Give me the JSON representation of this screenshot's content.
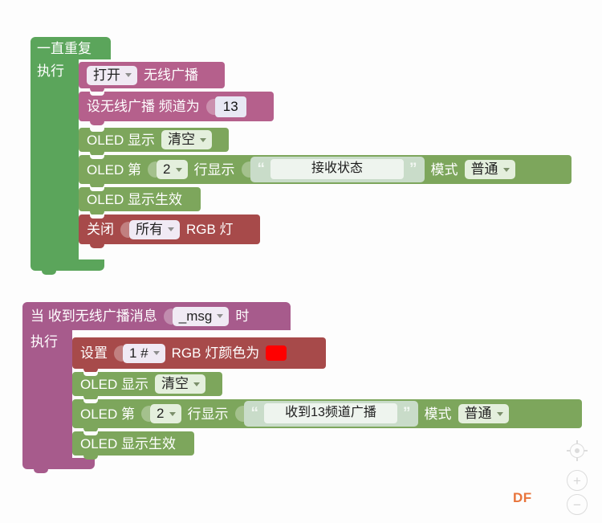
{
  "app": {
    "watermark": "DF",
    "background": "#fdfdfd"
  },
  "colors": {
    "loop_green": "#5BA55B",
    "oled_green": "#7DA65C",
    "wireless_pink": "#B5608C",
    "event_hat_purple": "#A75B8C",
    "rgb_red": "#A74A4A",
    "swatch_red": "#FF0000",
    "watermark_orange": "#E8743B"
  },
  "programs": [
    {
      "id": "forever-program",
      "header_label": "一直重复",
      "body_label": "执行",
      "statements": [
        {
          "id": "wireless-switch",
          "kind": "wireless",
          "prefix": "",
          "dropdown": "打开",
          "suffix": "无线广播"
        },
        {
          "id": "wireless-channel",
          "kind": "wireless",
          "prefix": "设无线广播 频道为",
          "number": "13"
        },
        {
          "id": "oled-show-clear",
          "kind": "oled",
          "prefix": "OLED 显示",
          "dropdown": "清空"
        },
        {
          "id": "oled-line-text",
          "kind": "oled",
          "prefix": "OLED 第",
          "line_dropdown": "2",
          "mid": "行显示",
          "text_value": "接收状态",
          "mode_label": "模式",
          "mode_dropdown": "普通"
        },
        {
          "id": "oled-refresh",
          "kind": "oled",
          "prefix": "OLED 显示生效"
        },
        {
          "id": "rgb-off",
          "kind": "rgb",
          "prefix": "关闭",
          "dropdown": "所有",
          "suffix": "RGB 灯"
        }
      ]
    },
    {
      "id": "on-message-program",
      "header_prefix": "当 收到无线广播消息",
      "header_dropdown": "_msg",
      "header_suffix": "时",
      "body_label": "执行",
      "statements": [
        {
          "id": "rgb-set-color",
          "kind": "rgb",
          "prefix": "设置",
          "dropdown": "1 #",
          "suffix": "RGB 灯颜色为",
          "color": "#FF0000"
        },
        {
          "id": "oled-show-clear-2",
          "kind": "oled",
          "prefix": "OLED 显示",
          "dropdown": "清空"
        },
        {
          "id": "oled-line-text-2",
          "kind": "oled",
          "prefix": "OLED 第",
          "line_dropdown": "2",
          "mid": "行显示",
          "text_value": "收到13频道广播",
          "mode_label": "模式",
          "mode_dropdown": "普通"
        },
        {
          "id": "oled-refresh-2",
          "kind": "oled",
          "prefix": "OLED 显示生效"
        }
      ]
    }
  ],
  "controls": {
    "center_icon": "crosshair-icon",
    "zoom_in": "+",
    "zoom_out": "−"
  }
}
